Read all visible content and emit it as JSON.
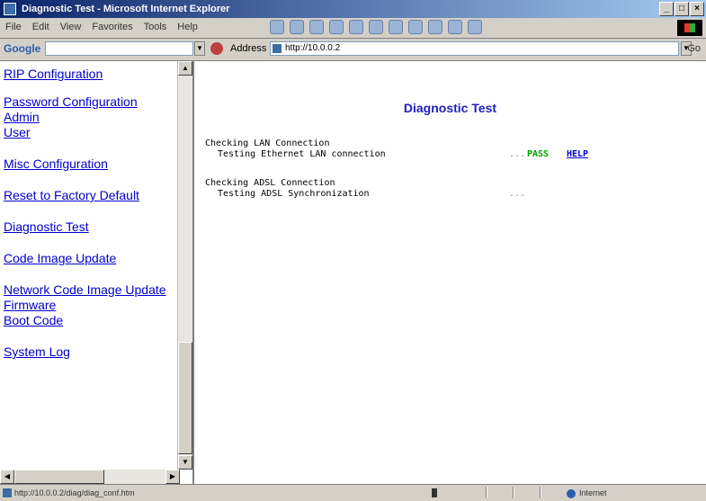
{
  "window": {
    "title": "Diagnostic Test - Microsoft Internet Explorer"
  },
  "menubar": {
    "items": [
      "File",
      "Edit",
      "View",
      "Favorites",
      "Tools",
      "Help"
    ]
  },
  "google_toolbar": {
    "label": "Google"
  },
  "address_bar": {
    "label": "Address",
    "url": "http://10.0.0.2",
    "go_label": "Go"
  },
  "nav": {
    "items": [
      {
        "label": "RIP Configuration"
      },
      {
        "label": "Password Configuration"
      },
      {
        "label": "Admin"
      },
      {
        "label": "User"
      },
      {
        "label": "Misc Configuration"
      },
      {
        "label": "Reset to Factory Default"
      },
      {
        "label": "Diagnostic Test"
      },
      {
        "label": "Code Image Update"
      },
      {
        "label": "Network Code Image Update"
      },
      {
        "label": "Firmware"
      },
      {
        "label": "Boot Code"
      },
      {
        "label": "System Log"
      }
    ]
  },
  "main": {
    "title": "Diagnostic Test",
    "sections": [
      {
        "heading": "Checking LAN Connection",
        "test": "Testing Ethernet LAN connection",
        "dots": "...",
        "result": "PASS",
        "help": "HELP"
      },
      {
        "heading": "Checking ADSL Connection",
        "test": "Testing ADSL Synchronization",
        "dots": "..."
      }
    ]
  },
  "statusbar": {
    "text": "http://10.0.0.2/diag/diag_conf.htm",
    "zone": "Internet"
  },
  "colors": {
    "link": "#0000cc",
    "title": "#2020c0",
    "pass": "#00a000"
  }
}
